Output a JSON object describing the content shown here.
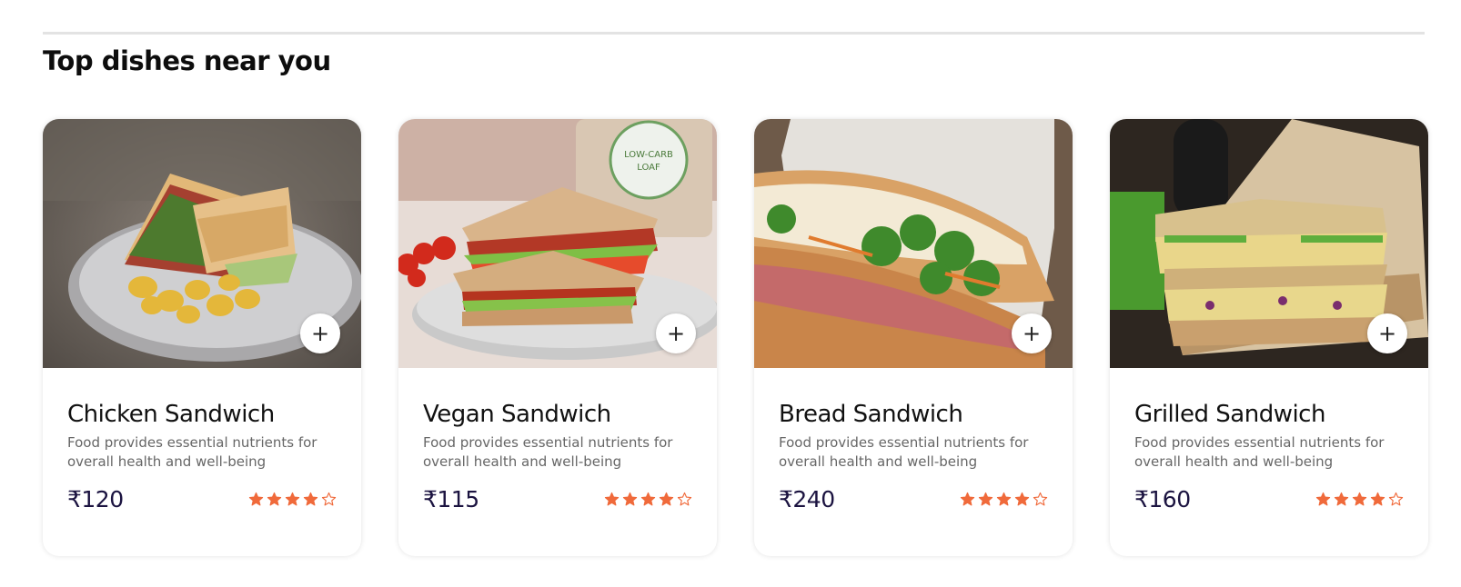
{
  "section": {
    "title": "Top dishes near you"
  },
  "colors": {
    "star": "#f06a3b",
    "price": "#1b1340",
    "divider": "#e3e3e3"
  },
  "add_button_label": "+",
  "dishes": [
    {
      "name": "Chicken Sandwich",
      "description": "Food provides essential nutrients for overall health and well-being",
      "price": "₹120",
      "rating": 4,
      "rating_max": 5,
      "image_icon": "chicken-sandwich-photo"
    },
    {
      "name": "Vegan Sandwich",
      "description": "Food provides essential nutrients for overall health and well-being",
      "price": "₹115",
      "rating": 4,
      "rating_max": 5,
      "image_icon": "vegan-sandwich-photo"
    },
    {
      "name": "Bread Sandwich",
      "description": "Food provides essential nutrients for overall health and well-being",
      "price": "₹240",
      "rating": 4,
      "rating_max": 5,
      "image_icon": "bread-sandwich-photo"
    },
    {
      "name": "Grilled Sandwich",
      "description": "Food provides essential nutrients for overall health and well-being",
      "price": "₹160",
      "rating": 4,
      "rating_max": 5,
      "image_icon": "grilled-sandwich-photo"
    }
  ]
}
